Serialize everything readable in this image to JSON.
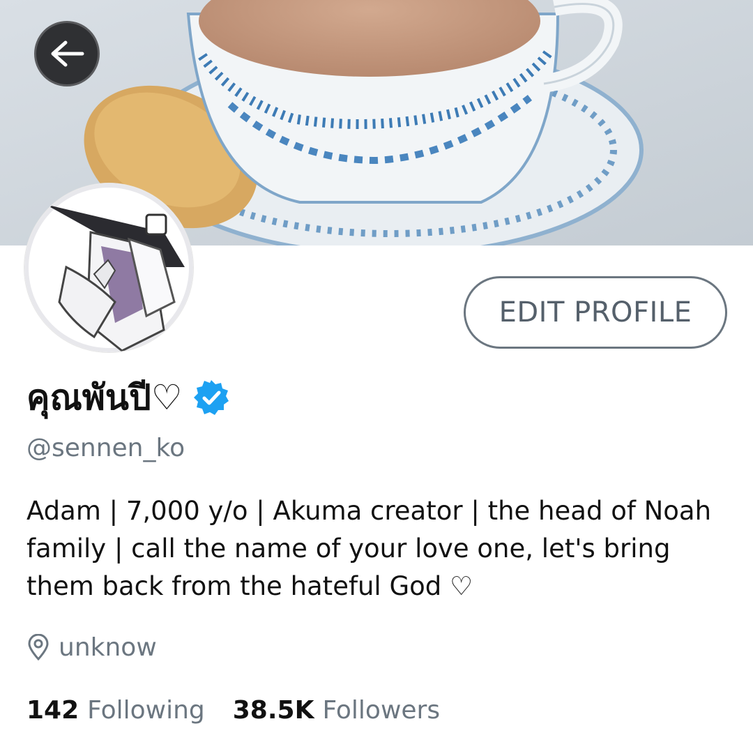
{
  "profile": {
    "display_name": "คุณพันปี♡",
    "handle": "@sennen_ko",
    "bio": "Adam | 7,000 y/o | Akuma creator | the head of Noah family | call the name of your love one, let's bring them back from the hateful God ♡",
    "location": "unknow",
    "following_count": "142",
    "following_label": "Following",
    "followers_count": "38.5K",
    "followers_label": "Followers",
    "verified": true
  },
  "actions": {
    "edit_profile_label": "EDIT PROFILE"
  },
  "icons": {
    "back": "back-arrow-icon",
    "verified": "verified-badge-icon",
    "location": "location-pin-icon"
  },
  "colors": {
    "verified": "#1da1f2",
    "secondary_text": "#6b7680",
    "primary_text": "#111111"
  }
}
